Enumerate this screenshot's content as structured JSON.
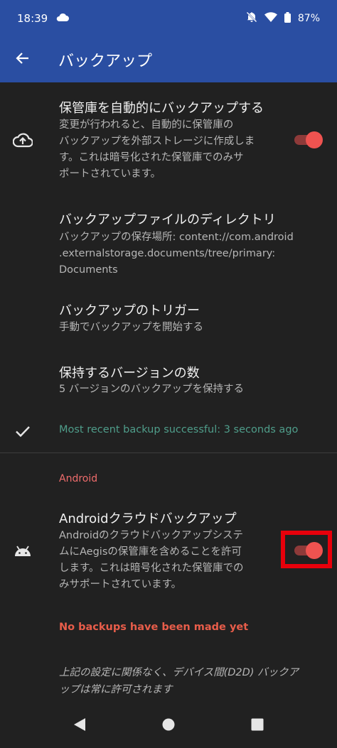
{
  "status_bar": {
    "time": "18:39",
    "battery": "87%"
  },
  "app_bar": {
    "title": "バックアップ"
  },
  "prefs": {
    "auto_backup": {
      "title": "保管庫を自動的にバックアップする",
      "summary": "変更が行われると、自動的に保管庫の\nバックアップを外部ストレージに作成しま\nす。これは暗号化された保管庫でのみサ\nポートされています。",
      "enabled": true
    },
    "directory": {
      "title": "バックアップファイルのディレクトリ",
      "summary": "バックアップの保存場所: content://com.android\n.externalstorage.documents/tree/primary:\nDocuments"
    },
    "trigger": {
      "title": "バックアップのトリガー",
      "summary": "手動でバックアップを開始する"
    },
    "versions": {
      "title": "保持するバージョンの数",
      "summary": "5 バージョンのバックアップを保持する"
    },
    "backup_status": "Most recent backup successful: 3 seconds ago"
  },
  "android_section": {
    "category": "Android",
    "cloud_backup": {
      "title": "Androidクラウドバックアップ",
      "summary": "Androidのクラウドバックアップシステ\nムにAegisの保管庫を含めることを許可\nします。これは暗号化された保管庫での\nみサポートされています。",
      "enabled": true
    },
    "backup_status": "No backups have been made yet",
    "note": "上記の設定に関係なく、デバイス間(D2D) バックア\nップは常に許可されます"
  },
  "colors": {
    "app_bar": "#2a4ea2",
    "accent": "#ef5350",
    "success": "#4f9d8a",
    "warning": "#e85d4a",
    "highlight": "#e8000b"
  },
  "icons": {
    "back": "arrow-left-icon",
    "auto_backup": "cloud-upload-icon",
    "status_ok": "checkmark-icon",
    "cloud_backup": "android-icon"
  }
}
